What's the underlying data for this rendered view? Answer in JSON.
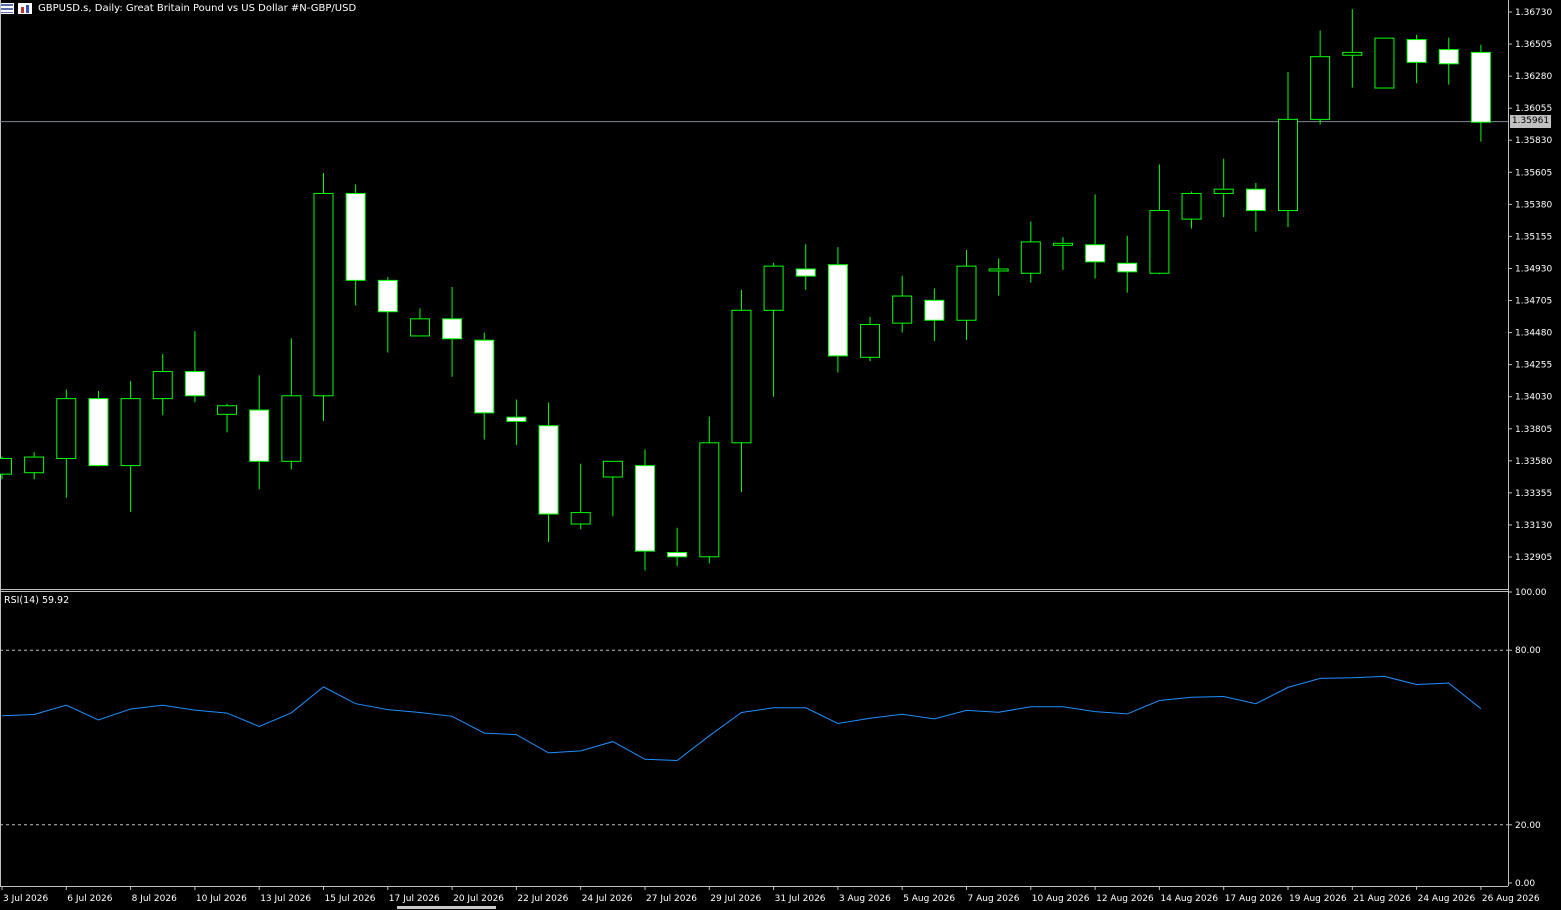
{
  "header": {
    "title": "GBPUSD.s, Daily:  Great Britain Pound vs US Dollar #N-GBP/USD",
    "icons": [
      "list-icon",
      "window-icon"
    ]
  },
  "price_axis": {
    "ticks": [
      "1.36730",
      "1.36505",
      "1.36280",
      "1.36055",
      "1.35830",
      "1.35605",
      "1.35380",
      "1.35155",
      "1.34930",
      "1.34705",
      "1.34480",
      "1.34255",
      "1.34030",
      "1.33805",
      "1.33580",
      "1.33355",
      "1.33130",
      "1.32905"
    ],
    "bid_label": "1.35961"
  },
  "rsi": {
    "label": "RSI(14) 59.92",
    "axis_ticks": [
      "100.00",
      "80.00",
      "20.00",
      "0.00"
    ]
  },
  "time_axis": {
    "labels": [
      "3 Jul 2026",
      "6 Jul 2026",
      "8 Jul 2026",
      "10 Jul 2026",
      "13 Jul 2026",
      "15 Jul 2026",
      "17 Jul 2026",
      "20 Jul 2026",
      "22 Jul 2026",
      "24 Jul 2026",
      "27 Jul 2026",
      "29 Jul 2026",
      "31 Jul 2026",
      "3 Aug 2026",
      "5 Aug 2026",
      "7 Aug 2026",
      "10 Aug 2026",
      "12 Aug 2026",
      "14 Aug 2026",
      "17 Aug 2026",
      "19 Aug 2026",
      "21 Aug 2026",
      "24 Aug 2026",
      "26 Aug 2026"
    ]
  },
  "colors": {
    "background": "#000000",
    "bull_outline": "#00ff00",
    "bear_fill": "#ffffff",
    "rsi_line": "#1e90ff",
    "bid_line": "#778899",
    "grid_level": "#c0c0c0"
  },
  "chart_data": {
    "type": "candlestick",
    "symbol": "GBPUSD.s",
    "timeframe": "Daily",
    "ylim": [
      1.328,
      1.3685
    ],
    "bid": 1.35961,
    "candles": [
      {
        "o": 1.3349,
        "h": 1.3361,
        "l": 1.3345,
        "c": 1.336
      },
      {
        "o": 1.335,
        "h": 1.3364,
        "l": 1.3345,
        "c": 1.3361
      },
      {
        "o": 1.336,
        "h": 1.3408,
        "l": 1.3332,
        "c": 1.3402
      },
      {
        "o": 1.3402,
        "h": 1.3407,
        "l": 1.3354,
        "c": 1.3355
      },
      {
        "o": 1.3355,
        "h": 1.3414,
        "l": 1.3322,
        "c": 1.3402
      },
      {
        "o": 1.3402,
        "h": 1.3433,
        "l": 1.339,
        "c": 1.3421
      },
      {
        "o": 1.3421,
        "h": 1.3449,
        "l": 1.3399,
        "c": 1.3404
      },
      {
        "o": 1.3391,
        "h": 1.3398,
        "l": 1.3378,
        "c": 1.3397
      },
      {
        "o": 1.3394,
        "h": 1.3418,
        "l": 1.3338,
        "c": 1.3358
      },
      {
        "o": 1.3358,
        "h": 1.3444,
        "l": 1.3352,
        "c": 1.3404
      },
      {
        "o": 1.3404,
        "h": 1.356,
        "l": 1.3386,
        "c": 1.3546
      },
      {
        "o": 1.3546,
        "h": 1.3552,
        "l": 1.3467,
        "c": 1.3485
      },
      {
        "o": 1.3485,
        "h": 1.3487,
        "l": 1.3434,
        "c": 1.3463
      },
      {
        "o": 1.3446,
        "h": 1.3465,
        "l": 1.3446,
        "c": 1.3458
      },
      {
        "o": 1.3458,
        "h": 1.348,
        "l": 1.3417,
        "c": 1.3444
      },
      {
        "o": 1.3443,
        "h": 1.3448,
        "l": 1.3373,
        "c": 1.3392
      },
      {
        "o": 1.3389,
        "h": 1.3401,
        "l": 1.3369,
        "c": 1.3386
      },
      {
        "o": 1.3383,
        "h": 1.3399,
        "l": 1.3301,
        "c": 1.3321
      },
      {
        "o": 1.3314,
        "h": 1.3356,
        "l": 1.331,
        "c": 1.3322
      },
      {
        "o": 1.3347,
        "h": 1.3358,
        "l": 1.3319,
        "c": 1.3358
      },
      {
        "o": 1.3355,
        "h": 1.3366,
        "l": 1.3281,
        "c": 1.3295
      },
      {
        "o": 1.3294,
        "h": 1.3311,
        "l": 1.3284,
        "c": 1.3291
      },
      {
        "o": 1.3291,
        "h": 1.3389,
        "l": 1.3286,
        "c": 1.3371
      },
      {
        "o": 1.3371,
        "h": 1.3478,
        "l": 1.3336,
        "c": 1.3464
      },
      {
        "o": 1.3464,
        "h": 1.3497,
        "l": 1.3403,
        "c": 1.3495
      },
      {
        "o": 1.3493,
        "h": 1.351,
        "l": 1.3478,
        "c": 1.3488
      },
      {
        "o": 1.3496,
        "h": 1.3508,
        "l": 1.342,
        "c": 1.3432
      },
      {
        "o": 1.3431,
        "h": 1.3459,
        "l": 1.3428,
        "c": 1.3454
      },
      {
        "o": 1.3455,
        "h": 1.3488,
        "l": 1.3448,
        "c": 1.3474
      },
      {
        "o": 1.3471,
        "h": 1.3479,
        "l": 1.3442,
        "c": 1.3457
      },
      {
        "o": 1.3457,
        "h": 1.3506,
        "l": 1.3443,
        "c": 1.3495
      },
      {
        "o": 1.3492,
        "h": 1.35,
        "l": 1.3474,
        "c": 1.3493
      },
      {
        "o": 1.349,
        "h": 1.3526,
        "l": 1.3483,
        "c": 1.3512
      },
      {
        "o": 1.351,
        "h": 1.3515,
        "l": 1.3492,
        "c": 1.3511
      },
      {
        "o": 1.351,
        "h": 1.3545,
        "l": 1.3486,
        "c": 1.3498
      },
      {
        "o": 1.3497,
        "h": 1.3516,
        "l": 1.3476,
        "c": 1.3491
      },
      {
        "o": 1.349,
        "h": 1.3566,
        "l": 1.3489,
        "c": 1.3534
      },
      {
        "o": 1.3528,
        "h": 1.3547,
        "l": 1.3521,
        "c": 1.3546
      },
      {
        "o": 1.3546,
        "h": 1.357,
        "l": 1.3529,
        "c": 1.3549
      },
      {
        "o": 1.3549,
        "h": 1.3553,
        "l": 1.3519,
        "c": 1.3534
      },
      {
        "o": 1.3534,
        "h": 1.3631,
        "l": 1.3522,
        "c": 1.3598
      },
      {
        "o": 1.3598,
        "h": 1.366,
        "l": 1.3594,
        "c": 1.3642
      },
      {
        "o": 1.3643,
        "h": 1.3675,
        "l": 1.362,
        "c": 1.3645
      },
      {
        "o": 1.362,
        "h": 1.3655,
        "l": 1.362,
        "c": 1.3655
      },
      {
        "o": 1.3654,
        "h": 1.3657,
        "l": 1.3623,
        "c": 1.3638
      },
      {
        "o": 1.3647,
        "h": 1.3655,
        "l": 1.3622,
        "c": 1.3637
      },
      {
        "o": 1.3645,
        "h": 1.365,
        "l": 1.3582,
        "c": 1.3596
      }
    ],
    "rsi": {
      "period": 14,
      "last": 59.92,
      "levels": [
        80,
        20
      ],
      "ylim": [
        0,
        100
      ],
      "values": [
        57.5,
        57.9,
        61.1,
        56.0,
        59.8,
        61.1,
        59.4,
        58.4,
        53.8,
        58.5,
        67.4,
        61.6,
        59.6,
        58.6,
        57.3,
        51.5,
        51.0,
        44.7,
        45.4,
        48.6,
        42.5,
        42.1,
        50.6,
        58.6,
        60.2,
        60.2,
        54.8,
        56.6,
        58.0,
        56.4,
        59.3,
        58.7,
        60.6,
        60.6,
        58.9,
        58.1,
        62.7,
        63.8,
        64.1,
        61.6,
        67.2,
        70.3,
        70.5,
        71.0,
        68.2,
        68.7,
        59.9
      ]
    }
  }
}
